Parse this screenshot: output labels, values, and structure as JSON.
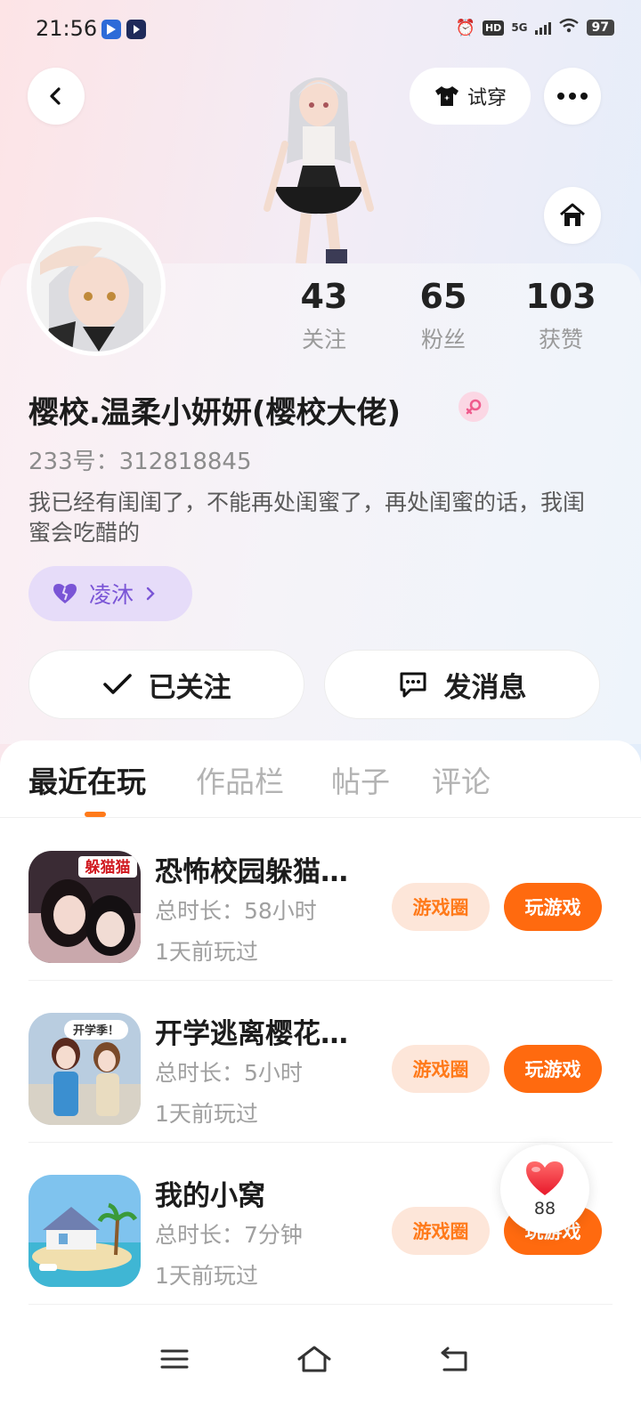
{
  "status_bar": {
    "time": "21:56",
    "hd_label": "HD",
    "network_label": "5G",
    "battery": "97"
  },
  "header": {
    "tryon_label": "试穿"
  },
  "profile": {
    "stats": [
      {
        "value": "43",
        "label": "关注"
      },
      {
        "value": "65",
        "label": "粉丝"
      },
      {
        "value": "103",
        "label": "获赞"
      }
    ],
    "username": "樱校.温柔小妍妍(樱校大佬)",
    "gender": "female",
    "user_id": "233号：312818845",
    "bio": "我已经有闺闺了，不能再处闺蜜了，再处闺蜜的话，我闺蜜会吃醋的",
    "tag_label": "凌沐",
    "follow_label": "已关注",
    "message_label": "发消息"
  },
  "tabs": [
    {
      "label": "最近在玩",
      "active": true
    },
    {
      "label": "作品栏",
      "active": false
    },
    {
      "label": "帖子",
      "active": false
    },
    {
      "label": "评论",
      "active": false
    }
  ],
  "games": [
    {
      "name": "恐怖校园躲猫…",
      "duration": "总时长：58小时",
      "last_played": "1天前玩过",
      "circle_label": "游戏圈",
      "play_label": "玩游戏",
      "icon_text": "躲猫猫"
    },
    {
      "name": "开学逃离樱花…",
      "duration": "总时长：5小时",
      "last_played": "1天前玩过",
      "circle_label": "游戏圈",
      "play_label": "玩游戏",
      "icon_text": "开学季！"
    },
    {
      "name": "我的小窝",
      "duration": "总时长：7分钟",
      "last_played": "1天前玩过",
      "circle_label": "游戏圈",
      "play_label": "玩游戏",
      "icon_text": ""
    }
  ],
  "like_float": {
    "count": "88"
  },
  "colors": {
    "accent_orange": "#ff6a0f",
    "chip_bg": "#fde6d9",
    "tag_purple": "#7a55d6",
    "tag_bg": "#e6dcf9"
  }
}
